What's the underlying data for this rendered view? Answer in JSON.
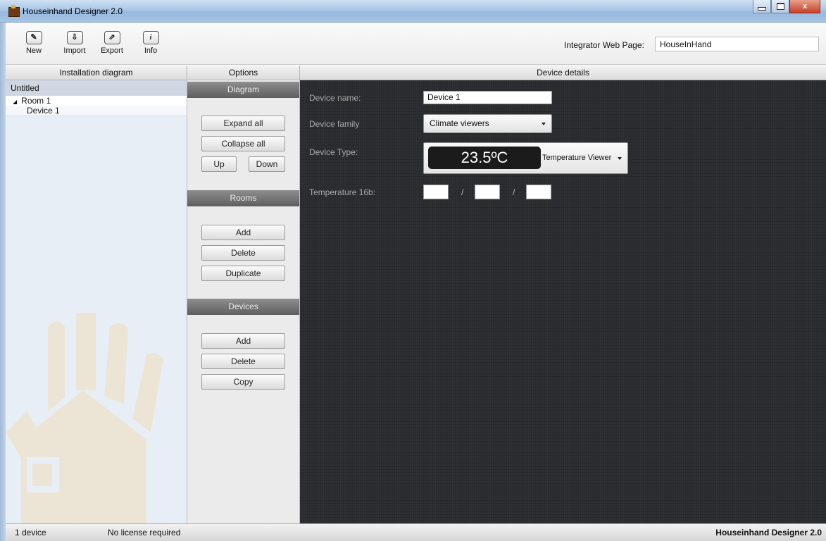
{
  "window": {
    "title": "Houseinhand Designer 2.0",
    "controls": {
      "minimize": "minimize",
      "maximize": "maximize",
      "close": "x"
    }
  },
  "toolbar": {
    "buttons": [
      {
        "label": "New",
        "icon": "edit-icon",
        "glyph": "✎"
      },
      {
        "label": "Import",
        "icon": "import-icon",
        "glyph": "⇩"
      },
      {
        "label": "Export",
        "icon": "export-icon",
        "glyph": "⇗"
      },
      {
        "label": "Info",
        "icon": "info-icon",
        "glyph": "i"
      }
    ],
    "integrator_label": "Integrator Web Page:",
    "integrator_value": "HouseInHand"
  },
  "columns": {
    "left": "Installation diagram",
    "middle": "Options",
    "right": "Device details"
  },
  "tree": {
    "root": "Untitled",
    "room": "Room 1",
    "device": "Device 1"
  },
  "options": {
    "diagram": {
      "title": "Diagram",
      "expand": "Expand all",
      "collapse": "Collapse all",
      "up": "Up",
      "down": "Down"
    },
    "rooms": {
      "title": "Rooms",
      "add": "Add",
      "delete": "Delete",
      "duplicate": "Duplicate"
    },
    "devices": {
      "title": "Devices",
      "add": "Add",
      "delete": "Delete",
      "copy": "Copy"
    }
  },
  "details": {
    "name_label": "Device name:",
    "name_value": "Device 1",
    "family_label": "Device family",
    "family_value": "Climate viewers",
    "type_label": "Device Type:",
    "type_display": "23.5ºC",
    "type_value": "Temperature Viewer",
    "temp_label": "Temperature 16b:",
    "temp_sep": "/",
    "temp_fields": [
      "",
      "",
      ""
    ]
  },
  "status": {
    "count": "1 device",
    "license": "No license required",
    "app": "Houseinhand Designer 2.0"
  },
  "colors": {
    "detail_bg": "#2b2c2f",
    "section_header": "#6e6e6e",
    "tree_bg": "#e8eef5",
    "titlebar": "#a9c6e6"
  }
}
